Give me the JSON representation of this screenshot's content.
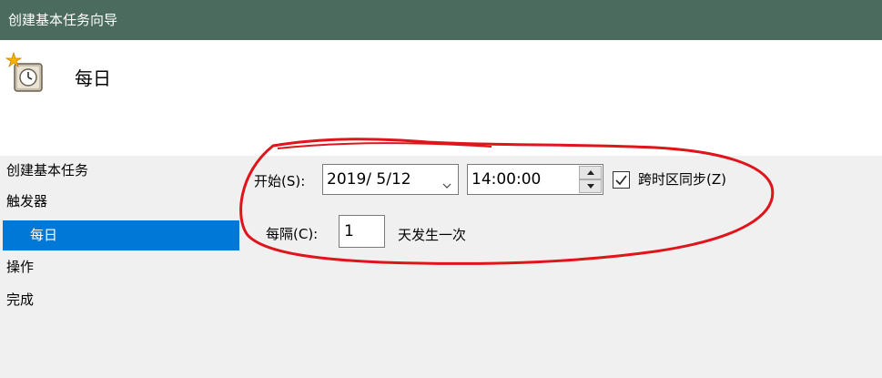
{
  "window": {
    "title": "创建基本任务向导"
  },
  "header": {
    "title": "每日",
    "icon": "scheduled-task-clock-icon"
  },
  "nav": {
    "items": [
      {
        "label": "创建基本任务"
      },
      {
        "label": "触发器"
      },
      {
        "label": "每日",
        "selected": true
      },
      {
        "label": "操作"
      },
      {
        "label": "完成"
      }
    ]
  },
  "form": {
    "start_label": "开始(S):",
    "start_date": "2019/  5/12",
    "start_time": "14:00:00",
    "sync_label": "跨时区同步(Z)",
    "sync_checked": true,
    "every_label": "每隔(C):",
    "every_value": "1",
    "every_suffix": "天发生一次"
  },
  "colors": {
    "titlebar": "#4a6b5d",
    "selection": "#0078d7",
    "annotation": "#e0141b"
  }
}
